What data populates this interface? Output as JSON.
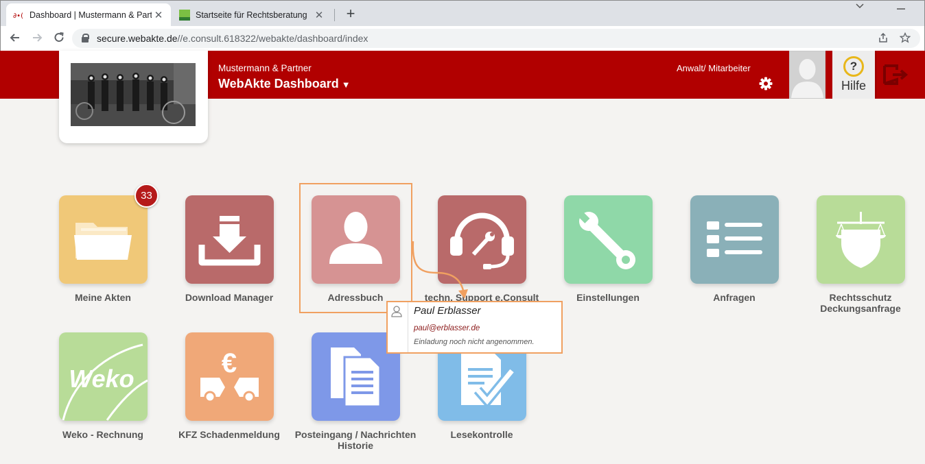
{
  "browser": {
    "tabs": [
      {
        "label": "Dashboard | Mustermann & Partner"
      },
      {
        "label": "Startseite für Rechtsberatung"
      }
    ],
    "url_host": "secure.webakte.de",
    "url_path": "//e.consult.618322/webakte/dashboard/index"
  },
  "header": {
    "firm": "Mustermann & Partner",
    "title": "WebAkte Dashboard",
    "title_caret": "▼",
    "role": "Anwalt/ Mitarbeiter",
    "help_label": "Hilfe",
    "help_symbol": "?"
  },
  "tiles": [
    {
      "label": "Meine Akten",
      "color": "#f0c878",
      "icon": "folder-icon"
    },
    {
      "label": "Download Manager",
      "color": "#b96a6a",
      "icon": "download-icon"
    },
    {
      "label": "Adressbuch",
      "color": "#d69393",
      "icon": "person-icon"
    },
    {
      "label": "techn. Support e.Consult",
      "color": "#b96a6a",
      "icon": "headset-icon"
    },
    {
      "label": "Einstellungen",
      "color": "#8fd8a8",
      "icon": "wrench-icon"
    },
    {
      "label": "Anfragen",
      "color": "#8ab0b8",
      "icon": "list-icon"
    },
    {
      "label_line1": "Rechtsschutz",
      "label_line2": "Deckungsanfrage",
      "color": "#b8dc98",
      "icon": "scales-shield-icon"
    },
    {
      "label": "Weko - Rechnung",
      "color": "#b8dc98",
      "icon": "weko-logo",
      "logo_text": "Weko"
    },
    {
      "label": "KFZ Schadenmeldung",
      "color": "#f0a878",
      "icon": "car-damage-icon",
      "symbol": "€"
    },
    {
      "label_line1": "Posteingang / Nachrichten",
      "label_line2": "Historie",
      "color": "#7e98e8",
      "icon": "documents-icon"
    },
    {
      "label": "Lesekontrolle",
      "color": "#80bce8",
      "icon": "document-check-icon"
    }
  ],
  "badge_count": "33",
  "contact_popup": {
    "name": "Paul Erblasser",
    "email": "paul@erblasser.de",
    "status": "Einladung noch nicht angenommen."
  }
}
